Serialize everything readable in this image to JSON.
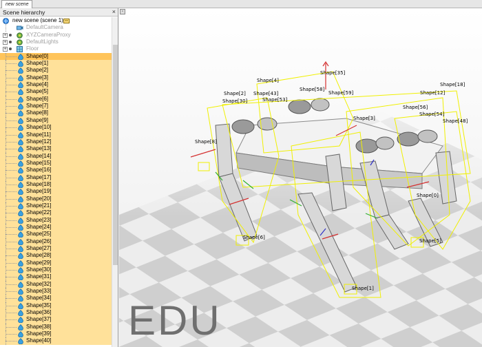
{
  "tab": {
    "label": "new scene"
  },
  "hierarchy": {
    "title": "Scene hierarchy",
    "close_glyph": "×",
    "scene": {
      "label": "new scene (scene 1)"
    },
    "objects": [
      {
        "label": "DefaultCamera",
        "icon": "camera-icon"
      },
      {
        "label": "XYZCameraProxy",
        "icon": "dummy-icon"
      },
      {
        "label": "DefaultLights",
        "icon": "light-icon"
      },
      {
        "label": "Floor",
        "icon": "floor-icon"
      }
    ],
    "shapes": [
      "Shape[0]",
      "Shape[1]",
      "Shape[2]",
      "Shape[3]",
      "Shape[4]",
      "Shape[5]",
      "Shape[6]",
      "Shape[7]",
      "Shape[8]",
      "Shape[9]",
      "Shape[10]",
      "Shape[11]",
      "Shape[12]",
      "Shape[13]",
      "Shape[14]",
      "Shape[15]",
      "Shape[16]",
      "Shape[17]",
      "Shape[18]",
      "Shape[19]",
      "Shape[20]",
      "Shape[21]",
      "Shape[22]",
      "Shape[23]",
      "Shape[24]",
      "Shape[25]",
      "Shape[26]",
      "Shape[27]",
      "Shape[28]",
      "Shape[29]",
      "Shape[30]",
      "Shape[31]",
      "Shape[32]",
      "Shape[33]",
      "Shape[34]",
      "Shape[35]",
      "Shape[36]",
      "Shape[37]",
      "Shape[38]",
      "Shape[39]",
      "Shape[40]"
    ]
  },
  "viewport": {
    "watermark": "EDU",
    "labels": {
      "shape35": "Shape[35]",
      "shape4": "Shape[4]",
      "shape43": "Shape[43]",
      "shape2": "Shape[2]",
      "shape30": "Shape[30]",
      "shape53": "Shape[53]",
      "shape59": "Shape[59]",
      "shape58": "Shape[58]",
      "shape18": "Shape[18]",
      "shape12": "Shape[12]",
      "shape56": "Shape[56]",
      "shape54": "Shape[54]",
      "shape48": "Shape[48]",
      "shape3": "Shape[3]",
      "shape0": "Shape[0]",
      "shape8": "Shape[8]",
      "shape6": "Shape[6]",
      "shape5": "Shape[5]",
      "shape1": "Shape[1]"
    }
  },
  "colors": {
    "selection": "#ffc45a",
    "shape_row": "#ffe19a",
    "bbox": "#f0f000"
  }
}
